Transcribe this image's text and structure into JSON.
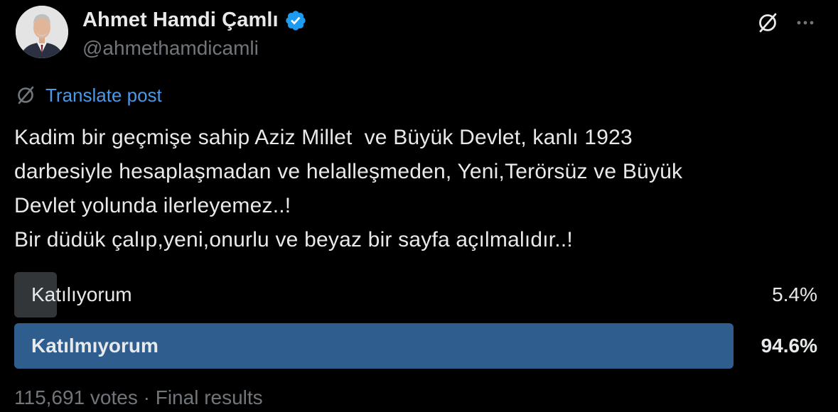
{
  "author": {
    "display_name": "Ahmet Hamdi Çamlı",
    "handle": "@ahmethamdicamli",
    "verified": true,
    "verified_color": "#1d9bf0"
  },
  "actions": {
    "grok_icon": "grok-icon",
    "more_icon": "more-horizontal-icon"
  },
  "translate": {
    "label": "Translate post",
    "icon": "grok-icon",
    "color": "#4a99e9"
  },
  "post": {
    "lines": [
      "Kadim bir geçmişe sahip Aziz Millet  ve Büyük Devlet, kanlı 1923",
      "darbesiyle hesaplaşmadan ve helalleşmeden, Yeni,Terörsüz ve Büyük",
      "Devlet yolunda ilerleyemez..!",
      "Bir düdük çalıp,yeni,onurlu ve beyaz bir sayfa açılmalıdır..!"
    ]
  },
  "poll": {
    "options": [
      {
        "label": "Katılıyorum",
        "percent_text": "5.4%",
        "percent": 5.4,
        "winner": false
      },
      {
        "label": "Katılmıyorum",
        "percent_text": "94.6%",
        "percent": 94.6,
        "winner": true
      }
    ],
    "winner_color": "#2f5d8e",
    "loser_color": "#333639",
    "votes": "115,691 votes",
    "separator": " · ",
    "status": "Final results"
  }
}
